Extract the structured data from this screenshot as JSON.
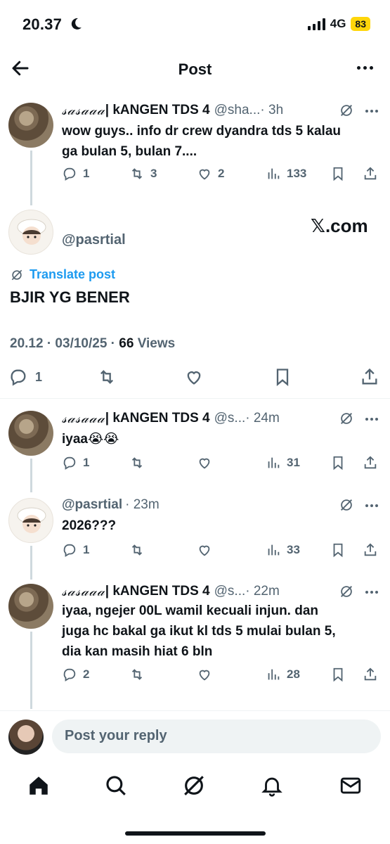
{
  "status_bar": {
    "time": "20.37",
    "network": "4G",
    "battery": "83"
  },
  "header": {
    "title": "Post"
  },
  "parent_tweet": {
    "name_fancy": "𝓈𝒶𝓈𝒶𝒶𝒶",
    "name_rest": " | kANGEN TDS 4",
    "handle": "@sha...",
    "time": "· 3h",
    "text_line1": "wow guys.. info dr crew dyandra tds 5 kalau",
    "text_line2": "ga bulan 5, bulan 7....",
    "replies": "1",
    "retweets": "3",
    "likes": "2",
    "views": "133"
  },
  "main_post": {
    "handle": "@pasrtial",
    "watermark": "𝕏.com",
    "translate": "Translate post",
    "text": "BJIR YG BENER",
    "time_date": "20.12 · 03/10/25 · ",
    "views_count": "66",
    "views_label": " Views",
    "replies": "1"
  },
  "replies": [
    {
      "name_fancy": "𝓈𝒶𝓈𝒶𝒶𝒶",
      "name_rest": " | kANGEN TDS 4",
      "handle": "@s...",
      "time": "· 24m",
      "text": "iyaa😭😭",
      "replies": "1",
      "views": "31"
    },
    {
      "handle": "@pasrtial",
      "time": "· 23m",
      "text": "2026???",
      "replies": "1",
      "views": "33"
    },
    {
      "name_fancy": "𝓈𝒶𝓈𝒶𝒶𝒶",
      "name_rest": " | kANGEN TDS 4",
      "handle": "@s...",
      "time": "· 22m",
      "text_line1": "iyaa, ngejer 00L wamil kecuali injun. dan",
      "text_line2": "juga hc bakal ga ikut kl tds 5 mulai bulan 5,",
      "text_line3": "dia kan masih hiat 6 bln",
      "replies": "2",
      "views": "28"
    }
  ],
  "reply_bar": {
    "placeholder": "Post your reply"
  },
  "icons": [
    "back-arrow-icon",
    "more-icon",
    "grok-icon",
    "reply-icon",
    "retweet-icon",
    "like-icon",
    "views-icon",
    "bookmark-icon",
    "share-icon",
    "home-icon",
    "search-icon",
    "grok-nav-icon",
    "bell-icon",
    "mail-icon"
  ]
}
